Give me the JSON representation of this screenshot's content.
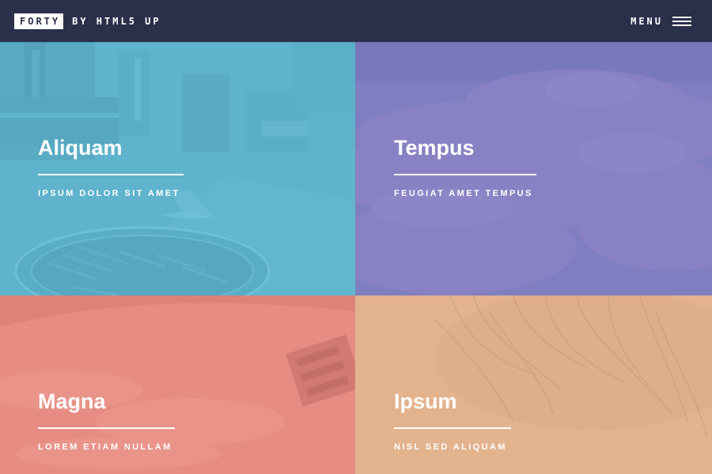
{
  "header": {
    "brand": "FORTY",
    "brand_sub": "BY HTML5 UP",
    "menu_label": "MENU",
    "menu_icon": "hamburger-icon",
    "background": "#2a2f4a"
  },
  "tiles": [
    {
      "title": "Aliquam",
      "subtitle": "IPSUM DOLOR SIT AMET",
      "color": "#5fb3cc",
      "image": "city-street-photo"
    },
    {
      "title": "Tempus",
      "subtitle": "FEUGIAT AMET TEMPUS",
      "color": "#7f7ec0",
      "image": "clouds-photo"
    },
    {
      "title": "Magna",
      "subtitle": "LOREM ETIAM NULLAM",
      "color": "#e68c83",
      "image": "earth-from-space-photo"
    },
    {
      "title": "Ipsum",
      "subtitle": "NISL SED ALIQUAM",
      "color": "#e3b38e",
      "image": "hair-photo"
    }
  ]
}
